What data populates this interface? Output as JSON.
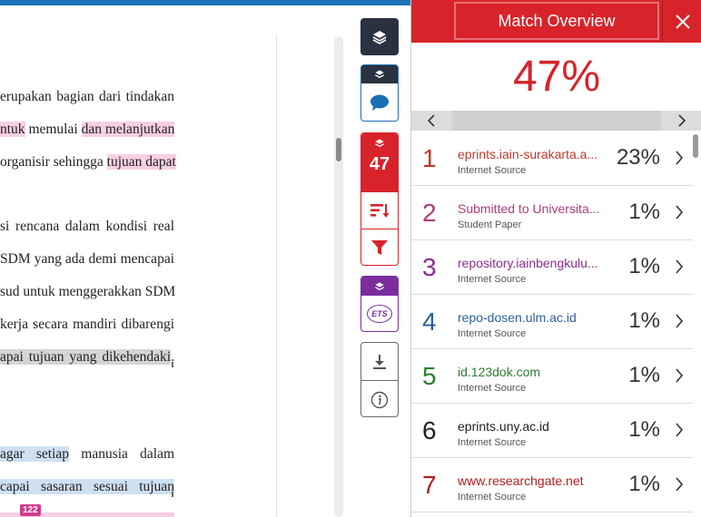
{
  "document": {
    "lines": [
      {
        "pre": "erupakan bagian dari tindakan",
        "hl": "",
        "post": ""
      },
      {
        "pre": "",
        "hl": "ntuk",
        "post": " memulai ",
        "hl2": "dan melanjutkan"
      },
      {
        "pre": "organisir sehingga ",
        "hl": "tujuan dapat",
        "post": ""
      },
      {
        "pre": "si rencana dalam kondisi real",
        "hl": "",
        "post": ""
      },
      {
        "pre": "SDM yang ada demi mencapai",
        "hl": "",
        "post": ""
      },
      {
        "pre": "sud untuk menggerakkan SDM",
        "hl": "",
        "post": ""
      },
      {
        "pre": "kerja secara mandiri dibarengi",
        "hl": "",
        "post": ""
      },
      {
        "pre": "",
        "hl": "apai tujuan yang dikehendaki",
        "post": "."
      },
      {
        "pre": "",
        "hl": " agar setiap",
        "post": " manusia dalam"
      },
      {
        "pre": "",
        "hl": "capai sasaran sesuai tujuan",
        "post": ""
      }
    ],
    "match_badge": "122"
  },
  "toolbar": {
    "match_count": "47",
    "ets_label": "ETS"
  },
  "panel": {
    "title": "Match Overview",
    "overall_percent": "47%",
    "sources": [
      {
        "rank": "1",
        "name": "eprints.iain-surakarta.a...",
        "type": "Internet Source",
        "percent": "23%",
        "color": "#c0392b"
      },
      {
        "rank": "2",
        "name": "Submitted to Universita...",
        "type": "Student Paper",
        "percent": "1%",
        "color": "#b03a7a"
      },
      {
        "rank": "3",
        "name": "repository.iainbengkulu...",
        "type": "Internet Source",
        "percent": "1%",
        "color": "#8e2d8e"
      },
      {
        "rank": "4",
        "name": "repo-dosen.ulm.ac.id",
        "type": "Internet Source",
        "percent": "1%",
        "color": "#2a5f9e"
      },
      {
        "rank": "5",
        "name": "id.123dok.com",
        "type": "Internet Source",
        "percent": "1%",
        "color": "#2e7d32"
      },
      {
        "rank": "6",
        "name": "eprints.uny.ac.id",
        "type": "Internet Source",
        "percent": "1%",
        "color": "#222222"
      },
      {
        "rank": "7",
        "name": "www.researchgate.net",
        "type": "Internet Source",
        "percent": "1%",
        "color": "#b71c1c"
      }
    ]
  }
}
